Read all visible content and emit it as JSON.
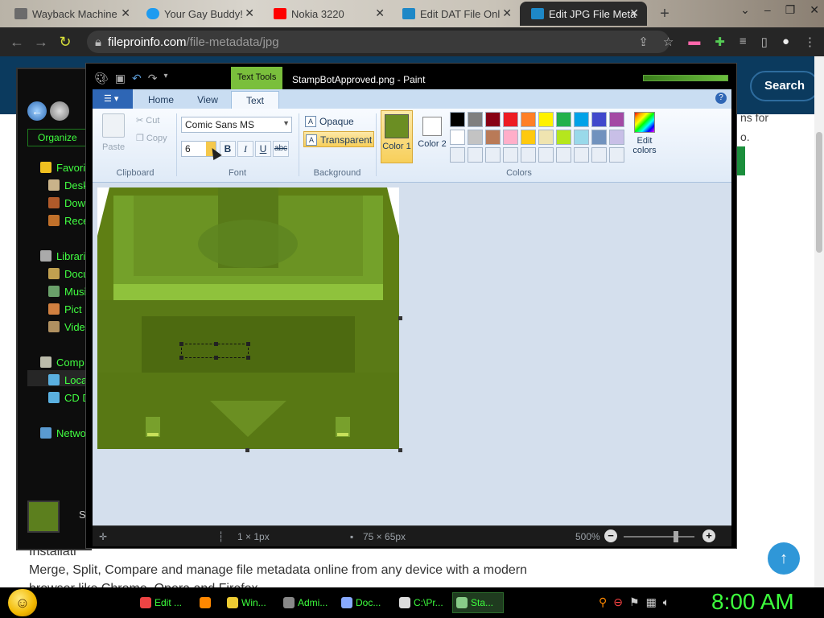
{
  "browser": {
    "tabs": [
      {
        "title": "Wayback Machine",
        "icon": "wayback-icon",
        "color": "#6b6b6b"
      },
      {
        "title": "Your Gay Buddy!",
        "icon": "twitter-icon",
        "color": "#1d9bf0"
      },
      {
        "title": "Nokia 3220",
        "icon": "youtube-icon",
        "color": "#ff0000"
      },
      {
        "title": "Edit DAT File Onl",
        "icon": "fileproinfo-icon",
        "color": "#1e88c7"
      },
      {
        "title": "Edit JPG File Meta",
        "icon": "fileproinfo-icon",
        "color": "#1e88c7"
      }
    ],
    "new_tab": "+",
    "url_host": "fileproinfo.com",
    "url_path": "/file-metadata/jpg"
  },
  "page": {
    "search_label": "Search",
    "side_text_1": "ns for",
    "side_text_2": "o.",
    "paragraph_line1": "Installati",
    "paragraph_line2": "Merge, Split, Compare and manage file metadata online from any device with a modern",
    "paragraph_line3": "browser like Chrome, Opera and Firefox.",
    "fab_icon": "↑"
  },
  "explorer": {
    "organize": "Organize",
    "items": [
      {
        "label": "Favori",
        "icon": "star-icon"
      },
      {
        "label": "Desk",
        "icon": "desktop-icon"
      },
      {
        "label": "Down",
        "icon": "downloads-icon"
      },
      {
        "label": "Rece",
        "icon": "recent-icon"
      },
      {
        "label": "Librari",
        "icon": "libraries-icon"
      },
      {
        "label": "Docu",
        "icon": "documents-icon"
      },
      {
        "label": "Musi",
        "icon": "music-icon"
      },
      {
        "label": "Pict",
        "icon": "pictures-icon"
      },
      {
        "label": "Vide",
        "icon": "videos-icon"
      },
      {
        "label": "Comp",
        "icon": "computer-icon"
      },
      {
        "label": "Loca",
        "icon": "drive-icon"
      },
      {
        "label": "CD D",
        "icon": "cd-icon"
      },
      {
        "label": "Netwo",
        "icon": "network-icon"
      }
    ],
    "thumb_label": "S"
  },
  "paint": {
    "title": "StampBotApproved.png - Paint",
    "context_tab": "Text Tools",
    "tabs": [
      "Home",
      "View",
      "Text"
    ],
    "clipboard": {
      "paste": "Paste",
      "cut": "Cut",
      "copy": "Copy",
      "label": "Clipboard"
    },
    "font": {
      "name": "Comic Sans MS",
      "size": "6",
      "bold": "B",
      "italic": "I",
      "underline": "U",
      "strike": "abc",
      "label": "Font"
    },
    "background": {
      "opaque": "Opaque",
      "transparent": "Transparent",
      "label": "Background"
    },
    "colors": {
      "color1": "Color 1",
      "color2": "Color 2",
      "edit": "Edit colors",
      "label": "Colors",
      "color1_value": "#6b8e23",
      "color2_value": "#ffffff",
      "palette_row1": [
        "#000000",
        "#7f7f7f",
        "#880015",
        "#ed1c24",
        "#ff7f27",
        "#fff200",
        "#22b14c",
        "#00a2e8",
        "#3f48cc",
        "#a349a4"
      ],
      "palette_row2": [
        "#ffffff",
        "#c3c3c3",
        "#b97a57",
        "#ffaec9",
        "#ffc90e",
        "#efe4b0",
        "#b5e61d",
        "#99d9ea",
        "#7092be",
        "#c8bfe7"
      ]
    },
    "status": {
      "cursor_size": "1 × 1px",
      "image_size": "75 × 65px",
      "zoom": "500%"
    }
  },
  "taskbar": {
    "items": [
      {
        "label": "Edit ...",
        "icon": "chrome-icon",
        "color": "#e44"
      },
      {
        "label": "",
        "icon": "firefox-icon",
        "color": "#f80"
      },
      {
        "label": "Win...",
        "icon": "folder-icon",
        "color": "#ec3"
      },
      {
        "label": "Admi...",
        "icon": "cmd-icon",
        "color": "#888"
      },
      {
        "label": "Doc...",
        "icon": "document-icon",
        "color": "#8af"
      },
      {
        "label": "C:\\Pr...",
        "icon": "7zip-icon",
        "color": "#ddd"
      },
      {
        "label": "Sta...",
        "icon": "paint-icon",
        "color": "#8c8"
      }
    ],
    "clock": "8:00 AM"
  }
}
